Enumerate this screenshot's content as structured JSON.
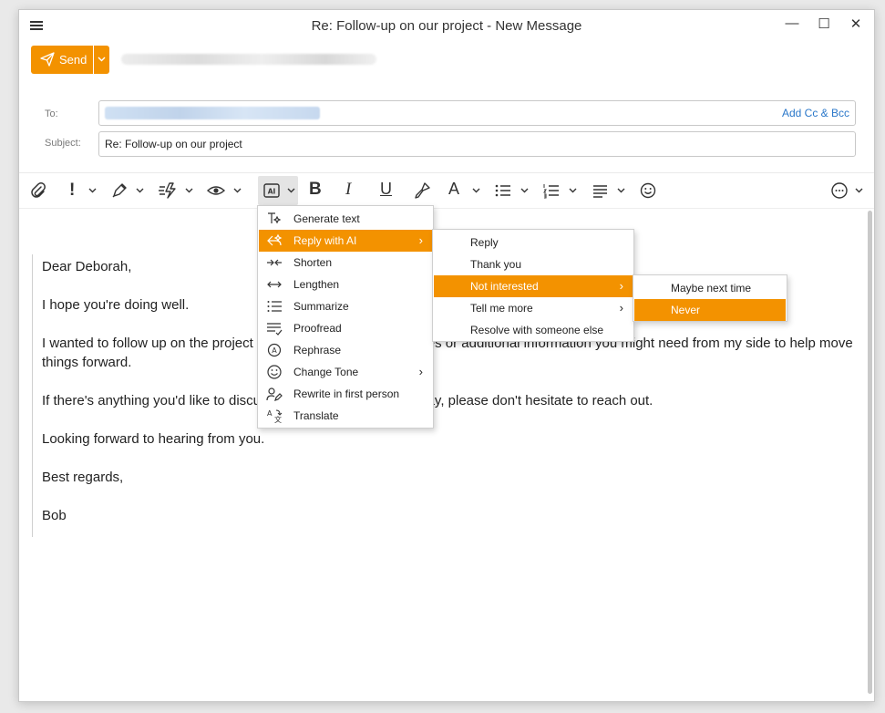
{
  "window": {
    "title": "Re: Follow-up on our project - New Message",
    "controls": {
      "minimize": "—",
      "maximize": "☐",
      "close": "✕"
    }
  },
  "compose": {
    "send_label": "Send",
    "to_label": "To:",
    "add_cc_bcc": "Add Cc & Bcc",
    "subject_label": "Subject:",
    "subject_value": "Re: Follow-up on our project"
  },
  "toolbar": {
    "icons": [
      "attach-icon",
      "importance-icon",
      "signature-icon",
      "quick-parts-icon",
      "preview-icon",
      "ai-assist-icon",
      "bold-icon",
      "italic-icon",
      "underline-icon",
      "format-painter-icon",
      "font-color-icon",
      "bullet-list-icon",
      "numbered-list-icon",
      "align-icon",
      "emoji-icon",
      "more-options-icon"
    ],
    "accent": "#f39200"
  },
  "body": {
    "paragraphs": [
      "Dear Deborah,",
      "I hope you're doing well.",
      "I wanted to follow up on the project to see if there are any updates or additional information you might need from my side to help move things forward.",
      "If there's anything you'd like to discuss or if I can assist in any way, please don't hesitate to reach out.",
      "Looking forward to hearing from you.",
      "Best regards,",
      "Bob"
    ]
  },
  "ai_menu": {
    "items": [
      {
        "label": "Generate text",
        "icon": "generate-text-icon"
      },
      {
        "label": "Reply with AI",
        "icon": "reply-ai-icon",
        "submenu": true,
        "selected": true
      },
      {
        "label": "Shorten",
        "icon": "shorten-icon"
      },
      {
        "label": "Lengthen",
        "icon": "lengthen-icon"
      },
      {
        "label": "Summarize",
        "icon": "summarize-icon"
      },
      {
        "label": "Proofread",
        "icon": "proofread-icon"
      },
      {
        "label": "Rephrase",
        "icon": "rephrase-icon"
      },
      {
        "label": "Change Tone",
        "icon": "tone-icon",
        "submenu": true
      },
      {
        "label": "Rewrite in first person",
        "icon": "first-person-icon"
      },
      {
        "label": "Translate",
        "icon": "translate-icon"
      }
    ]
  },
  "reply_menu": {
    "items": [
      {
        "label": "Reply"
      },
      {
        "label": "Thank you"
      },
      {
        "label": "Not interested",
        "submenu": true,
        "selected": true
      },
      {
        "label": "Tell me more",
        "submenu": true
      },
      {
        "label": "Resolve with someone else"
      }
    ]
  },
  "not_interested_menu": {
    "items": [
      {
        "label": "Maybe next time"
      },
      {
        "label": "Never",
        "selected": true
      }
    ]
  }
}
